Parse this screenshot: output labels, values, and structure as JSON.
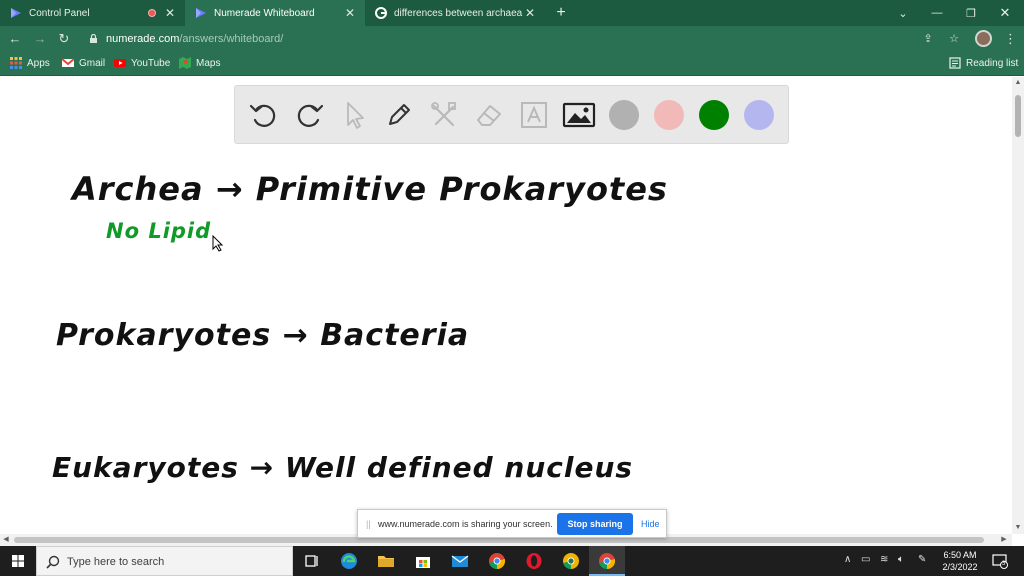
{
  "browser": {
    "tabs": [
      {
        "title": "Control Panel",
        "recording": true,
        "active": false
      },
      {
        "title": "Numerade Whiteboard",
        "recording": false,
        "active": true
      },
      {
        "title": "differences between archaea and",
        "recording": false,
        "active": false
      }
    ],
    "address": {
      "domain": "numerade.com",
      "path": "/answers/whiteboard/"
    },
    "bookmarks": [
      {
        "label": "Apps",
        "icon": "apps-grid-icon"
      },
      {
        "label": "Gmail",
        "icon": "gmail-icon"
      },
      {
        "label": "YouTube",
        "icon": "youtube-icon"
      },
      {
        "label": "Maps",
        "icon": "maps-icon"
      }
    ],
    "reading_list": "Reading list"
  },
  "whiteboard": {
    "tools": [
      "undo-icon",
      "redo-icon",
      "select-cursor-icon",
      "pen-icon",
      "tools-icon",
      "eraser-icon",
      "text-icon",
      "image-icon"
    ],
    "colors": {
      "gray": "#b1b1b1",
      "pink": "#f2b9b9",
      "green": "#008000",
      "lavender": "#b4b7ef"
    },
    "handwriting": {
      "line1": "Archea → Primitive Prokaryotes",
      "line1_note": "No Lipid",
      "line2": "Prokaryotes → Bacteria",
      "line3": "Eukaryotes → Well defined nucleus"
    },
    "ink_colors": {
      "black": "#111111",
      "green": "#129a28"
    }
  },
  "share_banner": {
    "message": "www.numerade.com is sharing your screen.",
    "stop_label": "Stop sharing",
    "hide_label": "Hide"
  },
  "taskbar": {
    "search_placeholder": "Type here to search",
    "time": "6:50 AM",
    "date": "2/3/2022",
    "notifications": "3"
  }
}
